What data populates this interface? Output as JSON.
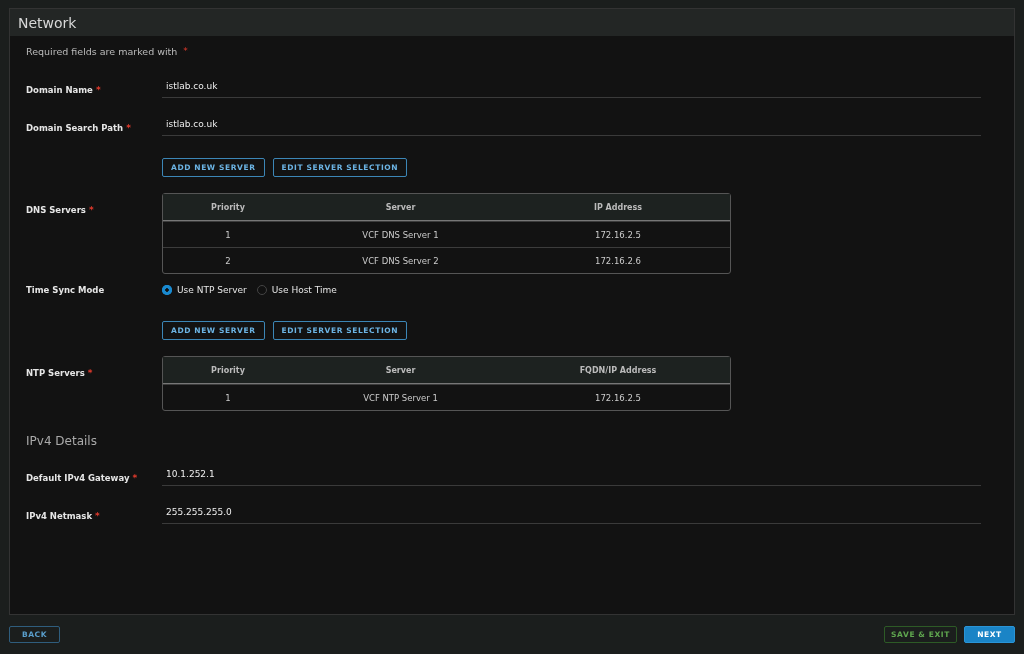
{
  "window": {
    "title": "Network"
  },
  "required_note": {
    "text": "Required fields are marked with",
    "mark": "*"
  },
  "rows": [
    {
      "kind": "field",
      "label": "Domain Name",
      "mark": "*",
      "value": "istlab.co.uk"
    },
    {
      "kind": "field",
      "label": "Domain Search Path",
      "mark": "*",
      "value": "istlab.co.uk"
    },
    {
      "kind": "buttons",
      "buttons": [
        "ADD NEW SERVER",
        "EDIT SERVER SELECTION"
      ]
    },
    {
      "kind": "table",
      "label": "DNS Servers",
      "mark": "*",
      "columns": [
        "Priority",
        "Server",
        "IP Address"
      ],
      "rows": [
        [
          "1",
          "VCF DNS Server 1",
          "172.16.2.5"
        ],
        [
          "2",
          "VCF DNS Server 2",
          "172.16.2.6"
        ]
      ]
    },
    {
      "kind": "radio",
      "label": "Time Sync Mode",
      "options": [
        {
          "label": "Use NTP Server",
          "selected": true
        },
        {
          "label": "Use Host Time",
          "selected": false
        }
      ]
    },
    {
      "kind": "buttons",
      "buttons": [
        "ADD NEW SERVER",
        "EDIT SERVER SELECTION"
      ]
    },
    {
      "kind": "table",
      "label": "NTP Servers",
      "mark": "*",
      "columns": [
        "Priority",
        "Server",
        "FQDN/IP Address"
      ],
      "rows": [
        [
          "1",
          "VCF NTP Server 1",
          "172.16.2.5"
        ]
      ]
    },
    {
      "kind": "heading",
      "label": "IPv4 Details"
    },
    {
      "kind": "field",
      "label": "Default IPv4 Gateway",
      "mark": "*",
      "value": "10.1.252.1"
    },
    {
      "kind": "field",
      "label": "IPv4 Netmask",
      "mark": "*",
      "value": "255.255.255.0"
    }
  ],
  "footer": {
    "back": "BACK",
    "save_exit": "SAVE & EXIT",
    "next": "NEXT"
  }
}
